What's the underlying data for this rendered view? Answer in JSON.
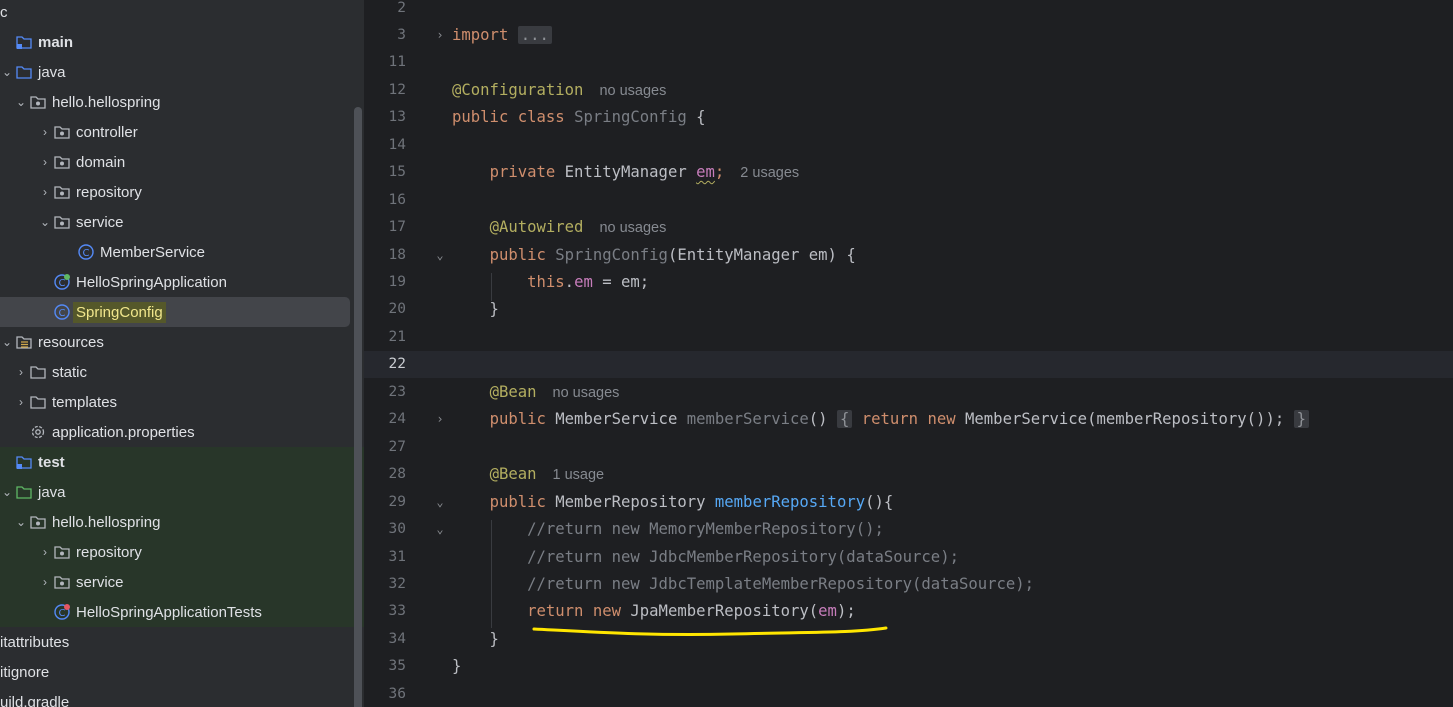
{
  "tree": {
    "rows": [
      {
        "indent": 0,
        "arrow": "",
        "icon": "none",
        "label": "c",
        "bold": false
      },
      {
        "indent": 0,
        "arrow": "",
        "icon": "module",
        "label": "main",
        "bold": true
      },
      {
        "indent": 0,
        "arrow": "⌄",
        "icon": "folder-blue",
        "label": "java",
        "bold": false
      },
      {
        "indent": 14,
        "arrow": "⌄",
        "icon": "package",
        "label": "hello.hellospring",
        "bold": false
      },
      {
        "indent": 38,
        "arrow": "›",
        "icon": "package",
        "label": "controller",
        "bold": false
      },
      {
        "indent": 38,
        "arrow": "›",
        "icon": "package",
        "label": "domain",
        "bold": false
      },
      {
        "indent": 38,
        "arrow": "›",
        "icon": "package",
        "label": "repository",
        "bold": false
      },
      {
        "indent": 38,
        "arrow": "⌄",
        "icon": "package",
        "label": "service",
        "bold": false
      },
      {
        "indent": 62,
        "arrow": "",
        "icon": "class",
        "label": "MemberService",
        "bold": false
      },
      {
        "indent": 38,
        "arrow": "",
        "icon": "spring-class",
        "label": "HelloSpringApplication",
        "bold": false
      },
      {
        "indent": 38,
        "arrow": "",
        "icon": "class",
        "label": "SpringConfig",
        "bold": false,
        "selected": true
      },
      {
        "indent": 0,
        "arrow": "⌄",
        "icon": "resources",
        "label": "resources",
        "bold": false
      },
      {
        "indent": 14,
        "arrow": "›",
        "icon": "folder",
        "label": "static",
        "bold": false
      },
      {
        "indent": 14,
        "arrow": "›",
        "icon": "folder",
        "label": "templates",
        "bold": false
      },
      {
        "indent": 14,
        "arrow": "",
        "icon": "gear",
        "label": "application.properties",
        "bold": false
      },
      {
        "indent": 0,
        "arrow": "",
        "icon": "module",
        "label": "test",
        "bold": true,
        "test": true
      },
      {
        "indent": 0,
        "arrow": "⌄",
        "icon": "folder-green",
        "label": "java",
        "bold": false,
        "test": true
      },
      {
        "indent": 14,
        "arrow": "⌄",
        "icon": "package",
        "label": "hello.hellospring",
        "bold": false,
        "test": true
      },
      {
        "indent": 38,
        "arrow": "›",
        "icon": "package",
        "label": "repository",
        "bold": false,
        "test": true
      },
      {
        "indent": 38,
        "arrow": "›",
        "icon": "package",
        "label": "service",
        "bold": false,
        "test": true
      },
      {
        "indent": 38,
        "arrow": "",
        "icon": "test-class",
        "label": "HelloSpringApplicationTests",
        "bold": false,
        "test": true
      },
      {
        "indent": 0,
        "arrow": "",
        "icon": "none",
        "label": "itattributes",
        "bold": false
      },
      {
        "indent": 0,
        "arrow": "",
        "icon": "none",
        "label": "itignore",
        "bold": false
      },
      {
        "indent": 0,
        "arrow": "",
        "icon": "none",
        "label": "uild.gradle",
        "bold": false
      }
    ]
  },
  "editor": {
    "lines": [
      {
        "n": "2",
        "fold": "",
        "tokens": []
      },
      {
        "n": "3",
        "fold": "›",
        "tokens": [
          [
            "kw",
            "import"
          ],
          [
            "p",
            " "
          ],
          [
            "fbox",
            "..."
          ]
        ]
      },
      {
        "n": "11",
        "fold": "",
        "tokens": []
      },
      {
        "n": "12",
        "fold": "",
        "tokens": [
          [
            "ann",
            "@Configuration"
          ],
          [
            "hint",
            "no usages"
          ]
        ]
      },
      {
        "n": "13",
        "fold": "",
        "tokens": [
          [
            "kw",
            "public class "
          ],
          [
            "fnd",
            "SpringConfig"
          ],
          [
            "p",
            " {"
          ]
        ]
      },
      {
        "n": "14",
        "fold": "",
        "tokens": []
      },
      {
        "n": "15",
        "fold": "",
        "tokens": [
          [
            "p",
            "    "
          ],
          [
            "kw",
            "private "
          ],
          [
            "p",
            "EntityManager "
          ],
          [
            "fldw",
            "em"
          ],
          [
            "kw",
            ";"
          ],
          [
            "hint",
            "2 usages"
          ]
        ]
      },
      {
        "n": "16",
        "fold": "",
        "tokens": []
      },
      {
        "n": "17",
        "fold": "",
        "tokens": [
          [
            "p",
            "    "
          ],
          [
            "ann",
            "@Autowired"
          ],
          [
            "hint",
            "no usages"
          ]
        ]
      },
      {
        "n": "18",
        "fold": "⌄",
        "tokens": [
          [
            "p",
            "    "
          ],
          [
            "kw",
            "public "
          ],
          [
            "fnd",
            "SpringConfig"
          ],
          [
            "p",
            "(EntityManager em) {"
          ]
        ]
      },
      {
        "n": "19",
        "fold": "",
        "tokens": [
          [
            "p",
            "        "
          ],
          [
            "kw",
            "this"
          ],
          [
            "p",
            "."
          ],
          [
            "fld",
            "em"
          ],
          [
            "p",
            " = em;"
          ]
        ]
      },
      {
        "n": "20",
        "fold": "",
        "tokens": [
          [
            "p",
            "    }"
          ]
        ]
      },
      {
        "n": "21",
        "fold": "",
        "tokens": []
      },
      {
        "n": "22",
        "fold": "",
        "tokens": [],
        "current": true
      },
      {
        "n": "23",
        "fold": "",
        "tokens": [
          [
            "p",
            "    "
          ],
          [
            "ann",
            "@Bean"
          ],
          [
            "hint",
            "no usages"
          ]
        ]
      },
      {
        "n": "24",
        "fold": "›",
        "tokens": [
          [
            "p",
            "    "
          ],
          [
            "kw",
            "public "
          ],
          [
            "p",
            "MemberService "
          ],
          [
            "fnd",
            "memberService"
          ],
          [
            "p",
            "() "
          ],
          [
            "fbox",
            "{"
          ],
          [
            "p",
            " "
          ],
          [
            "kw",
            "return new "
          ],
          [
            "p",
            "MemberService(memberRepository()); "
          ],
          [
            "fbox",
            "}"
          ]
        ]
      },
      {
        "n": "27",
        "fold": "",
        "tokens": []
      },
      {
        "n": "28",
        "fold": "",
        "tokens": [
          [
            "p",
            "    "
          ],
          [
            "ann",
            "@Bean"
          ],
          [
            "hint",
            "1 usage"
          ]
        ]
      },
      {
        "n": "29",
        "fold": "⌄",
        "tokens": [
          [
            "p",
            "    "
          ],
          [
            "kw",
            "public "
          ],
          [
            "p",
            "MemberRepository "
          ],
          [
            "fn",
            "memberRepository"
          ],
          [
            "p",
            "(){"
          ]
        ]
      },
      {
        "n": "30",
        "fold": "⌄",
        "tokens": [
          [
            "p",
            "        "
          ],
          [
            "cmt",
            "//return new MemoryMemberRepository();"
          ]
        ]
      },
      {
        "n": "31",
        "fold": "",
        "tokens": [
          [
            "p",
            "        "
          ],
          [
            "cmt",
            "//return new JdbcMemberRepository(dataSource);"
          ]
        ]
      },
      {
        "n": "32",
        "fold": "",
        "tokens": [
          [
            "p",
            "        "
          ],
          [
            "cmt",
            "//return new JdbcTemplateMemberRepository(dataSource);"
          ]
        ]
      },
      {
        "n": "33",
        "fold": "",
        "tokens": [
          [
            "p",
            "        "
          ],
          [
            "kw",
            "return new "
          ],
          [
            "p",
            "JpaMemberRepository("
          ],
          [
            "fld",
            "em"
          ],
          [
            "p",
            ");"
          ]
        ]
      },
      {
        "n": "34",
        "fold": "",
        "tokens": [
          [
            "p",
            "    }"
          ]
        ]
      },
      {
        "n": "35",
        "fold": "",
        "tokens": [
          [
            "p",
            "}"
          ]
        ]
      },
      {
        "n": "36",
        "fold": "",
        "tokens": []
      }
    ]
  },
  "colors": {
    "annotation_highlight": "#f0e68c",
    "underline_marker": "#ffe600"
  }
}
